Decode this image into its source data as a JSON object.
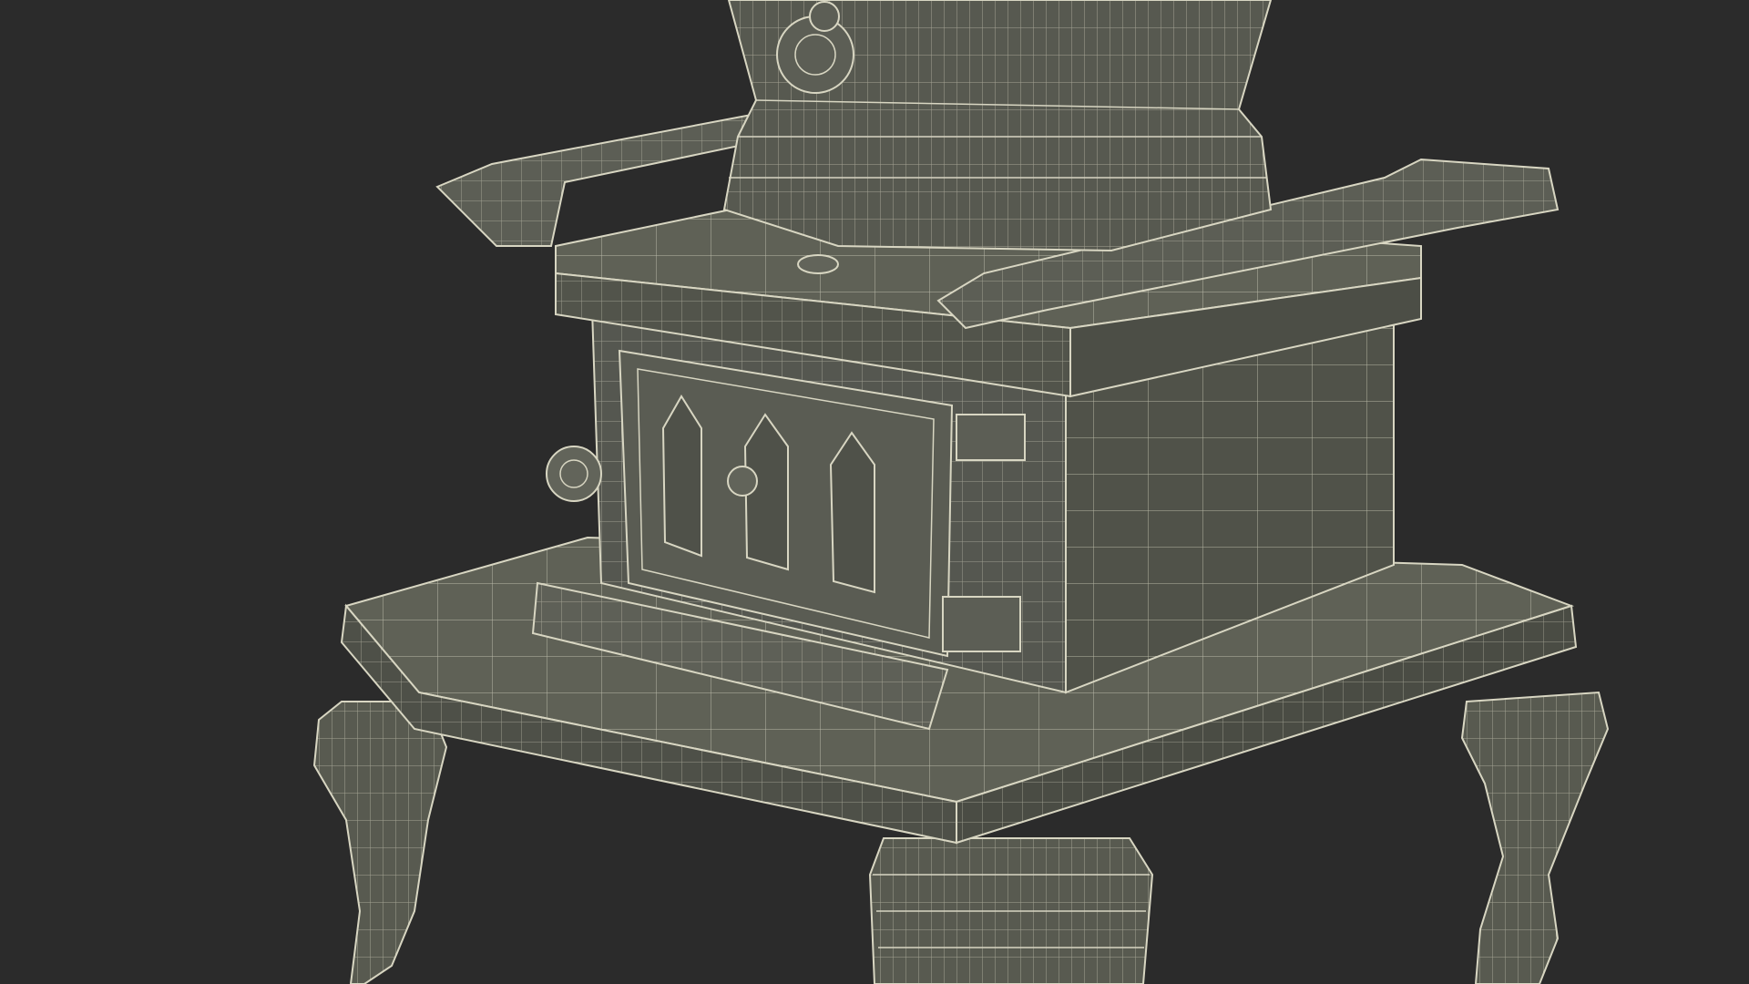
{
  "scene": {
    "subject": "wireframe-render",
    "colors": {
      "background": "#2b2b2b",
      "body_fill": "#585a50",
      "body_fill_dark": "#45473f",
      "body_fill_light": "#6a6c61",
      "wire": "#d8d6c2",
      "wire_faint": "#a9a794"
    }
  }
}
